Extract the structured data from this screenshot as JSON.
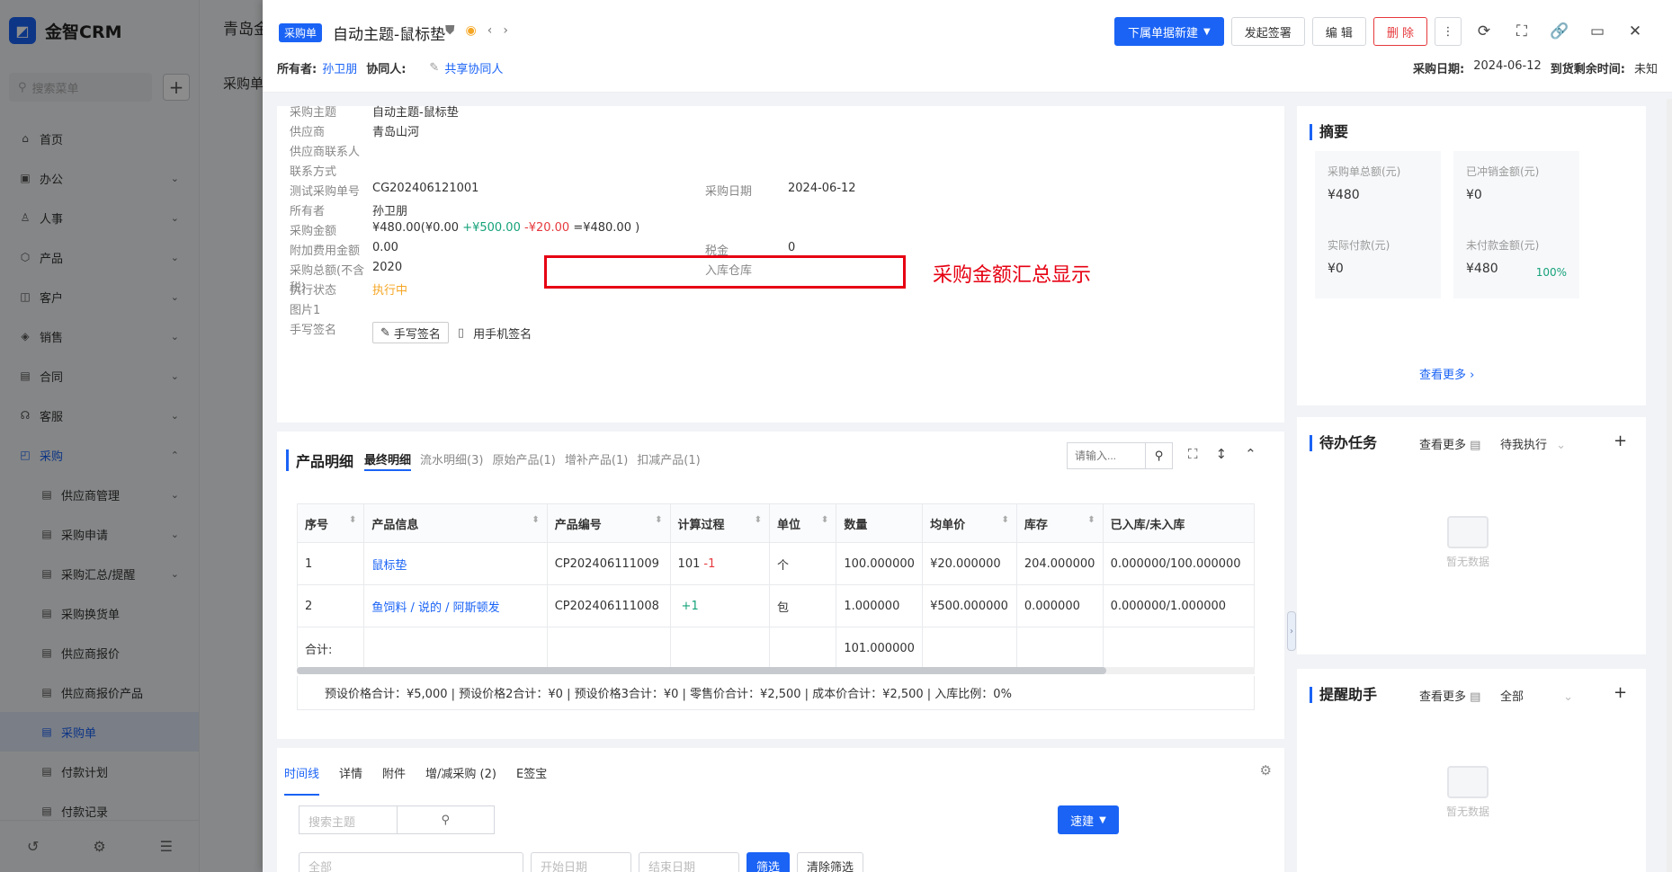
{
  "app": {
    "name": "金智CRM"
  },
  "sidebar": {
    "search_placeholder": "搜索菜单",
    "items": [
      {
        "label": "首页",
        "icon": "home-icon",
        "chevron": ""
      },
      {
        "label": "办公",
        "icon": "office-icon",
        "chevron": "⌄"
      },
      {
        "label": "人事",
        "icon": "people-icon",
        "chevron": "⌄"
      },
      {
        "label": "产品",
        "icon": "product-icon",
        "chevron": "⌄"
      },
      {
        "label": "客户",
        "icon": "customer-icon",
        "chevron": "⌄"
      },
      {
        "label": "销售",
        "icon": "sales-icon",
        "chevron": "⌄"
      },
      {
        "label": "合同",
        "icon": "contract-icon",
        "chevron": "⌄"
      },
      {
        "label": "客服",
        "icon": "service-icon",
        "chevron": "⌄"
      },
      {
        "label": "采购",
        "icon": "purchase-icon",
        "chevron": "⌃"
      }
    ],
    "sub_items": [
      {
        "label": "供应商管理",
        "chevron": "⌄"
      },
      {
        "label": "采购申请",
        "chevron": "⌄"
      },
      {
        "label": "采购汇总/提醒",
        "chevron": "⌄"
      },
      {
        "label": "采购换货单",
        "chevron": ""
      },
      {
        "label": "供应商报价",
        "chevron": ""
      },
      {
        "label": "供应商报价产品",
        "chevron": ""
      },
      {
        "label": "采购单",
        "chevron": ""
      },
      {
        "label": "付款计划",
        "chevron": ""
      },
      {
        "label": "付款记录",
        "chevron": ""
      }
    ]
  },
  "background": {
    "tab": "青岛金",
    "title": "采购单"
  },
  "drawer": {
    "tag": "采购单",
    "title": "自动主题-鼠标垫",
    "owner_label": "所有者:",
    "owner": "孙卫朋",
    "collab_label": "协同人:",
    "share_label": "共享协同人",
    "buttons": {
      "new": "下属单据新建",
      "sign": "发起签署",
      "edit": "编 辑",
      "delete": "删 除"
    },
    "purchase_date_label": "采购日期:",
    "purchase_date": "2024-06-12",
    "remaining_label": "到货剩余时间:",
    "remaining": "未知"
  },
  "info": {
    "fields_left": [
      {
        "label": "采购主题",
        "value": "自动主题-鼠标垫",
        "link": false
      },
      {
        "label": "供应商",
        "value": "青岛山河",
        "link": true
      },
      {
        "label": "供应商联系人",
        "value": "",
        "link": false
      },
      {
        "label": "联系方式",
        "value": "",
        "link": false
      },
      {
        "label": "测试采购单号",
        "value": "CG202406121001",
        "link": false
      },
      {
        "label": "所有者",
        "value": "孙卫朋",
        "link": false
      }
    ],
    "amount_label": "采购金额",
    "amount": {
      "total": "¥480.00(",
      "a": "¥0.00",
      "b": "+¥500.00",
      "c": "-¥20.00",
      "d": "=¥480.00 )"
    },
    "fields_left2": [
      {
        "label": "附加费用金额",
        "value": "0.00"
      },
      {
        "label": "采购总额(不含税)",
        "value": "2020"
      },
      {
        "label": "执行状态",
        "value": "执行中"
      },
      {
        "label": "图片1",
        "value": ""
      },
      {
        "label": "手写签名",
        "value": ""
      }
    ],
    "fields_right": [
      {
        "label": "采购日期",
        "value": "2024-06-12"
      },
      {
        "label": "税金",
        "value": "0"
      },
      {
        "label": "入库仓库",
        "value": ""
      }
    ],
    "sign_button": "手写签名",
    "mobile_sign": "用手机签名",
    "annotation": "采购金额汇总显示"
  },
  "products": {
    "header": "产品明细",
    "tabs": [
      "最终明细",
      "流水明细(3)",
      "原始产品(1)",
      "增补产品(1)",
      "扣减产品(1)"
    ],
    "search_placeholder": "请输入...",
    "columns": [
      "序号",
      "产品信息",
      "产品编号",
      "计算过程",
      "单位",
      "数量",
      "均单价",
      "库存",
      "已入库/未入库"
    ],
    "rows": [
      {
        "no": "1",
        "name": "鼠标垫",
        "code": "CP202406111009",
        "calc_a": "101",
        "calc_b": "-1",
        "unit": "个",
        "qty": "100.000000",
        "price": "¥20.000000",
        "stock": "204.000000",
        "inout": "0.000000/100.000000"
      },
      {
        "no": "2",
        "name": "鱼饲料 / 说的 / 阿斯顿发",
        "code": "CP202406111008",
        "calc_a": "",
        "calc_b": "+1",
        "unit": "包",
        "qty": "1.000000",
        "price": "¥500.000000",
        "stock": "0.000000",
        "inout": "0.000000/1.000000"
      }
    ],
    "total_label": "合计:",
    "total_qty": "101.000000",
    "totals_line": "预设价格合计：¥5,000 |   预设价格2合计：¥0 |   预设价格3合计：¥0 |   零售价合计：¥2,500 |   成本价合计：¥2,500 |   入库比例：0%"
  },
  "bottom": {
    "tabs": [
      "时间线",
      "详情",
      "附件",
      "增/减采购 (2)",
      "E签宝"
    ],
    "search_placeholder": "搜索主题",
    "quick": "速建",
    "filter1": "全部",
    "date_start": "开始日期",
    "date_end": "结束日期",
    "filter_btn": "筛选",
    "clear_btn": "清除筛选"
  },
  "summary": {
    "title": "摘要",
    "stats": [
      {
        "label": "采购单总额(元)",
        "value": "¥480",
        "pct": ""
      },
      {
        "label": "已冲销金额(元)",
        "value": "¥0",
        "pct": ""
      },
      {
        "label": "实际付款(元)",
        "value": "¥0",
        "pct": ""
      },
      {
        "label": "未付款金额(元)",
        "value": "¥480",
        "pct": "100%"
      }
    ],
    "more": "查看更多"
  },
  "todo": {
    "title": "待办任务",
    "more": "查看更多",
    "filter": "待我执行",
    "empty": "暂无数据"
  },
  "reminder": {
    "title": "提醒助手",
    "more": "查看更多",
    "filter": "全部",
    "empty": "暂无数据"
  }
}
